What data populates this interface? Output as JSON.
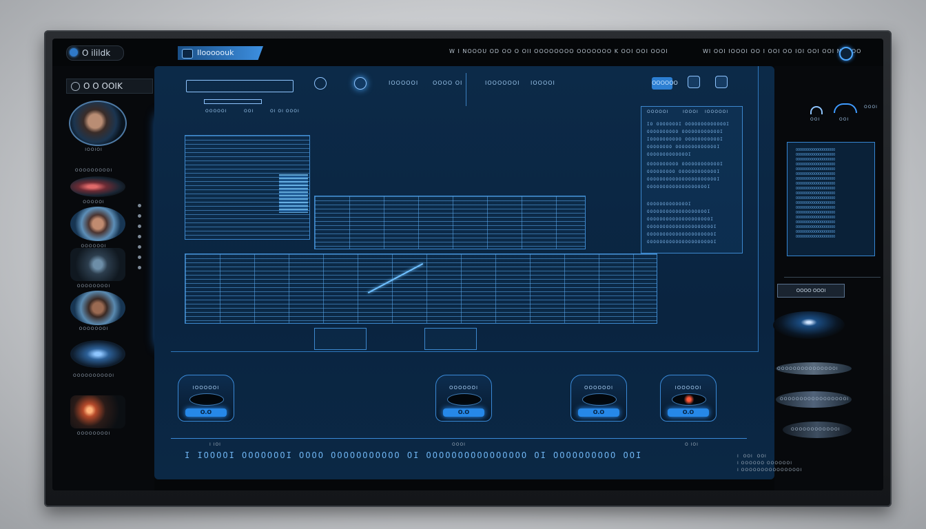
{
  "topbar": {
    "brand": "O ilildk",
    "active_tab": "I​Iooooouk",
    "status_left": "W I NOOOU OD  OO  O  OII  OOOOOOOO OOOOOOO K OOI OOI OOOI",
    "status_right": "WI OOI IOOOI OO I OOI OO IOI OOI  OOI NOI OO"
  },
  "sidebar": {
    "label": "O O OOIK",
    "items": [
      {
        "caption": "IOOIOI"
      },
      {
        "caption": "OOOOOOOOOI"
      },
      {
        "caption": "OOOOOI"
      },
      {
        "caption": "OOOOOOI"
      },
      {
        "caption": "OOOOOOOOI"
      },
      {
        "caption": "OOOOOOOI"
      },
      {
        "caption": "OOOOOOOOOOI"
      },
      {
        "caption": "OOOOOOOOI"
      }
    ]
  },
  "toolbar": {
    "labels": [
      "IOOOOOI",
      "OOOO  OI",
      "IOOOOOOI",
      "IOOOOI"
    ],
    "filter_button": "OOOOOO",
    "sub_labels": [
      "OOOOOI",
      "OOI",
      "OI OI OOOI"
    ]
  },
  "info_panel": {
    "header": [
      "OOOOOI",
      "IOOOI",
      "IOOOOOI"
    ],
    "lines_a": "IO OOOOOOOI OOOOOOOOOOOOOI\nOOOOOOOOOO OOOOOOOOOOOOI\nIOOOOOOOOOO OOOOOOOOOOOI\nOOOOOOOO OOOOOOOOOOOOOI\nOOOOOOOOOOOOOI",
    "lines_b": "OOOOOOOOOO OOOOOOOOOOOOI\nOOOOOOOOO OOOOOOOOOOOOI\nOOOOOOOOOOOOOOOOOOOOOOI\nOOOOOOOOOOOOOOOOOOOI",
    "lines_c": "OOOOOOOOOOOOOI\nOOOOOOOOOOOOOOOOOOOI\nOOOOOOOOOOOOOOOOOOOOI\nOOOOOOOOOOOOOOOOOOOOOI\nOOOOOOOOOOOOOOOOOOOOOI\nOOOOOOOOOOOOOOOOOOOOOI"
  },
  "gauges": [
    {
      "label": "IOOOOOI",
      "value": "O.O"
    },
    {
      "label": "OOOOOOI",
      "value": "O.O"
    },
    {
      "label": "OOOOOOI",
      "value": "O.O"
    },
    {
      "label": "IOOOOOI",
      "value": "O.O"
    }
  ],
  "footer": {
    "ticks": [
      "I IOI",
      "OOOI",
      "O IOI"
    ],
    "scroller": "I IOOOOI  OOOOOOOI  OOOO  OOOOOOOOOOO  OI  OOOOOOOOOOOOOOOO  OI  OOOOOOOOOO  OOI",
    "corner": "I  OOI  OOI\nI OOOOOO OOOOOOI\nI OOOOOOOOOOOOOOOI"
  },
  "right": {
    "mini_labels": [
      "OOI",
      "OOI",
      "OOOI"
    ],
    "grid_text": "OOOOOOOOOOOOOOOOOOO\nOOOOOOOOOOOOOOOOOOO\nOOOOOOOOOOOOOOOOOOO\nOOOOOOOOOOOOOOOOOOO\nOOOOOOOOOOOOOOOOOOO\nOOOOOOOOOOOOOOOOOOO\nOOOOOOOOOOOOOOOOOOO\nOOOOOOOOOOOOOOOOOOO\nOOOOOOOOOOOOOOOOOOO\nOOOOOOOOOOOOOOOOOOO\nOOOOOOOOOOOOOOOOOOO\nOOOOOOOOOOOOOOOOOOO\nOOOOOOOOOOOOOOOOOOO\nOOOOOOOOOOOOOOOOOOO\nOOOOOOOOOOOOOOOOOOO\nOOOOOOOOOOOOOOOOOOO\nOOOOOOOOOOOOOOOOOOO\nOOOOOOOOOOOOOOOOOOO\nOOOOOOOOOOOOOOOOOOO",
    "button": "OOOO OOOI",
    "cards": [
      "OOOOOOOOOOOOOOOI",
      "OOOOOOOOOOOOOOOOOI",
      "OOOOOOOOOOOOI"
    ]
  },
  "colors": {
    "accent": "#2f93ff",
    "panel": "#0c2a48",
    "bg": "#050709"
  }
}
